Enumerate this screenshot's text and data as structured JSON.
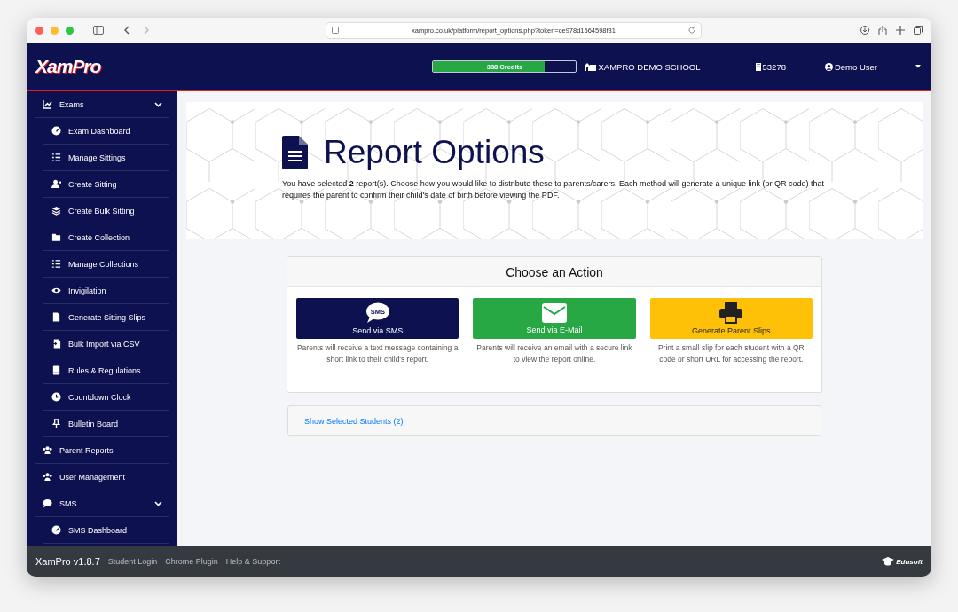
{
  "browser": {
    "url": "xampro.co.uk/platform/report_options.php?token=ce978d1564598f31"
  },
  "header": {
    "logo": "XamPro",
    "credits": {
      "label": "388 Credits",
      "level": 0.78
    },
    "school": "XAMPRO DEMO SCHOOL",
    "school_id": "53278",
    "user": "Demo User"
  },
  "sidebar": {
    "items": [
      {
        "label": "Exams",
        "expanded": true,
        "children": [
          {
            "label": "Exam Dashboard"
          },
          {
            "label": "Manage Sittings"
          },
          {
            "label": "Create Sitting"
          },
          {
            "label": "Create Bulk Sitting"
          },
          {
            "label": "Create Collection"
          },
          {
            "label": "Manage Collections"
          },
          {
            "label": "Invigilation"
          },
          {
            "label": "Generate Sitting Slips"
          },
          {
            "label": "Bulk Import via CSV"
          },
          {
            "label": "Rules & Regulations"
          },
          {
            "label": "Countdown Clock"
          },
          {
            "label": "Bulletin Board"
          }
        ]
      },
      {
        "label": "Parent Reports"
      },
      {
        "label": "User Management"
      },
      {
        "label": "SMS",
        "expanded": true,
        "children": [
          {
            "label": "SMS Dashboard"
          }
        ]
      }
    ]
  },
  "page": {
    "title": "Report Options",
    "intro": "You have selected **2** report(s). Choose how you would like to distribute these to parents/carers. Each method will generate a unique link (or QR code) that requires the parent to confirm their child's date of birth before viewing the PDF."
  },
  "actions": {
    "title": "Choose an Action",
    "items": [
      {
        "kind": "sms",
        "icon_text": "SMS",
        "label": "Send via SMS",
        "description": "Parents will receive a text message containing a short link to their child's report."
      },
      {
        "kind": "email",
        "label": "Send via E-Mail",
        "description": "Parents will receive an email with a secure link to view the report online."
      },
      {
        "kind": "print",
        "label": "Generate Parent Slips",
        "description": "Print a small slip for each student with a QR code or short URL for accessing the report."
      }
    ]
  },
  "selected_students_link": "Show Selected Students (2)",
  "footer": {
    "version": "XamPro v1.8.7",
    "links": [
      "Student Login",
      "Chrome Plugin",
      "Help & Support"
    ],
    "brand": "Edusoft"
  }
}
